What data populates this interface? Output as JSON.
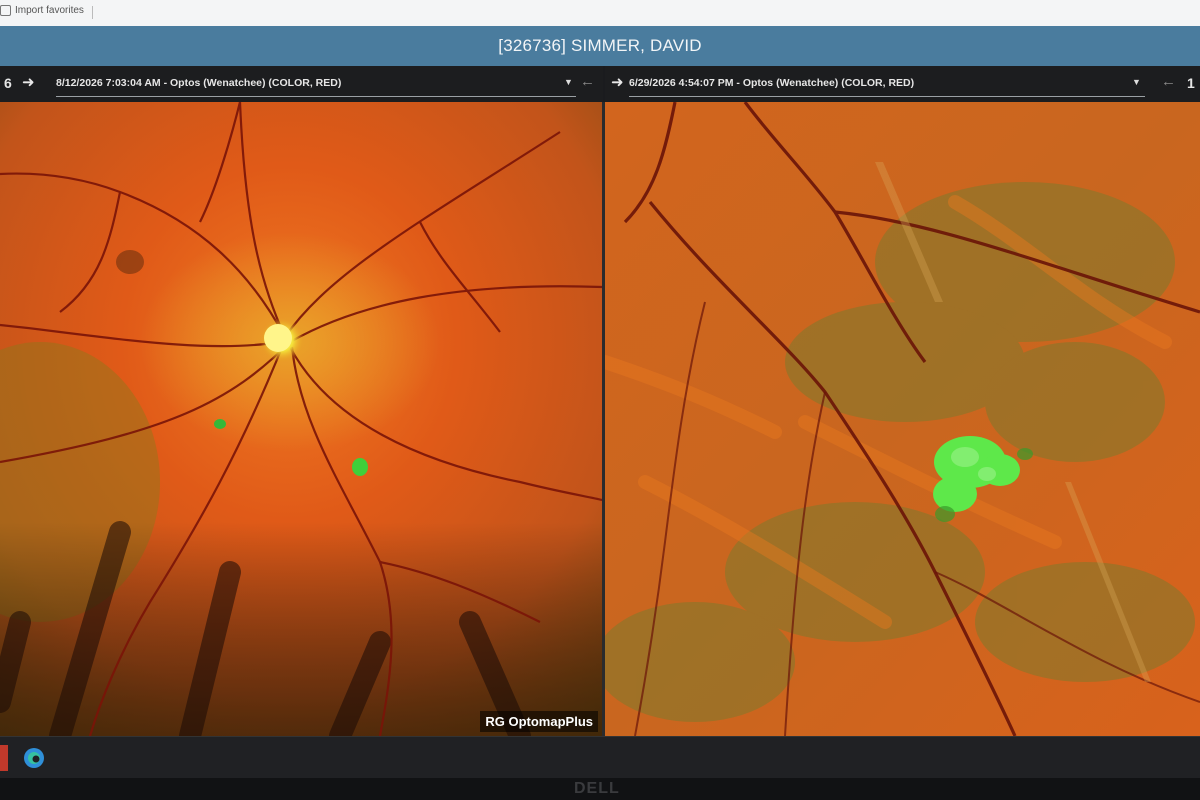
{
  "browser": {
    "bookmark_label": "Import favorites"
  },
  "app": {
    "patient_title": "[326736] SIMMER, DAVID"
  },
  "viewers": [
    {
      "index": "6",
      "label": "8/12/2026 7:03:04 AM - Optos (Wenatchee) (COLOR, RED)",
      "watermark": "RG OptomapPlus"
    },
    {
      "index": "1",
      "label": "6/29/2026 4:54:07 PM - Optos (Wenatchee) (COLOR, RED)"
    }
  ],
  "icons": {
    "next": "arrow-right-icon",
    "prev": "arrow-left-icon",
    "dropdown": "caret-down-icon",
    "taskbar_browser": "edge-browser-icon",
    "monitor_logo": "dell-logo"
  },
  "colors": {
    "title_bar": "#4a7c9e",
    "viewer_header": "#1c1d1f",
    "retina_orange": "#d9561e",
    "lesion_green": "#5ee84a"
  }
}
